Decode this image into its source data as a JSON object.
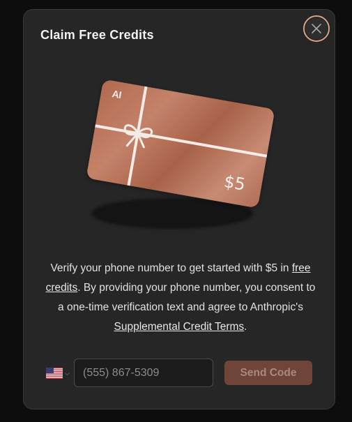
{
  "modal": {
    "title": "Claim Free Credits",
    "close_icon": "close-icon"
  },
  "card": {
    "logo": "AI",
    "amount": "$5"
  },
  "description": {
    "part1": "Verify your phone number to get started with $5 in ",
    "link1": "free credits",
    "part2": ". By providing your phone number, you consent to a one-time verification text and agree to Anthropic's ",
    "link2": "Supplemental Credit Terms",
    "part3": "."
  },
  "phone": {
    "country_flag": "us-flag-icon",
    "placeholder": "(555) 867-5309"
  },
  "send_button": {
    "label": "Send Code"
  },
  "colors": {
    "accent": "#d8a383",
    "card": "#b97458",
    "button_disabled": "#6e4536"
  }
}
